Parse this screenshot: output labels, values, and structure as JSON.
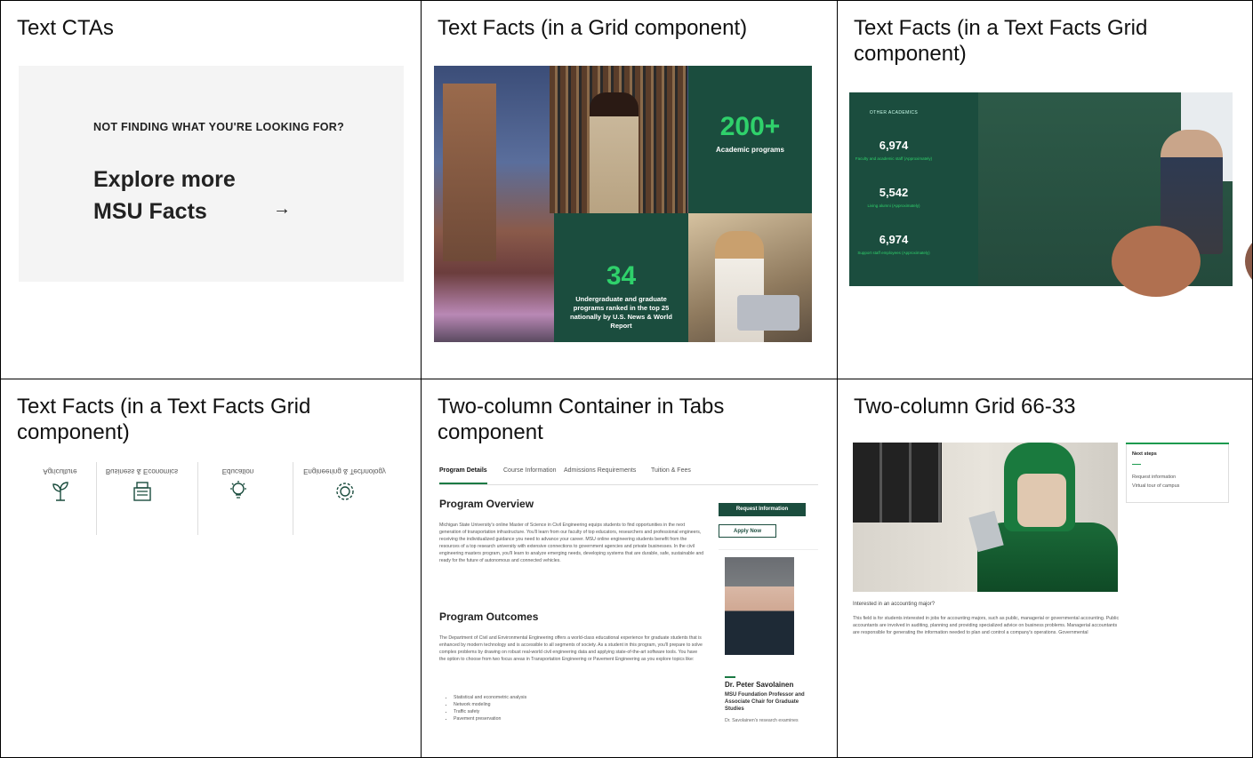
{
  "cells": {
    "c1": {
      "title": "Text CTAs"
    },
    "c2": {
      "title": "Text Facts (in a Grid component)"
    },
    "c3": {
      "title": "Text Facts (in a Text Facts Grid component)"
    },
    "c4": {
      "title": "Text Facts (in a Text Facts Grid component)"
    },
    "c5": {
      "title": "Two-column Container in Tabs component"
    },
    "c6": {
      "title": "Two-column Grid 66-33"
    }
  },
  "cta": {
    "eyebrow": "NOT FINDING WHAT YOU'RE LOOKING FOR?",
    "headline": "Explore more MSU Facts",
    "arrow": "→"
  },
  "grid_facts": {
    "fact1_number": "200+",
    "fact1_label": "Academic programs",
    "fact2_number": "34",
    "fact2_label": "Undergraduate and graduate programs ranked in the top 25 nationally by U.S. News & World Report"
  },
  "text_facts": {
    "eyebrow": "OTHER ACADEMICS",
    "facts": [
      {
        "number": "6,974",
        "label": "Faculty and academic staff (Approximately)"
      },
      {
        "number": "5,542",
        "label": "Living alumni (Approximately)"
      },
      {
        "number": "6,974",
        "label": "Support staff employees (Approximately)"
      }
    ]
  },
  "icon_facts": {
    "items": [
      {
        "label": "Agriculture",
        "icon": "plant-icon"
      },
      {
        "label": "Business & Economics",
        "icon": "register-icon"
      },
      {
        "label": "Education",
        "icon": "lightbulb-icon"
      },
      {
        "label": "Engineering & Technology",
        "icon": "gear-icon"
      }
    ]
  },
  "tabs_page": {
    "tabs": [
      "Program Details",
      "Course Information",
      "Admissions Requirements",
      "Tuition & Fees"
    ],
    "overview_heading": "Program Overview",
    "overview_text": "Michigan State University's online Master of Science in Civil Engineering equips students to find opportunities in the next generation of transportation infrastructure. You'll learn from our faculty of top educators, researchers and professional engineers, receiving the individualized guidance you need to advance your career. MSU online engineering students benefit from the resources of a top research university with extensive connections to government agencies and private businesses. In the civil engineering masters program, you'll learn to analyze emerging needs, developing systems that are durable, safe, sustainable and ready for the future of autonomous and connected vehicles.",
    "outcomes_heading": "Program Outcomes",
    "outcomes_text": "The Department of Civil and Environmental Engineering offers a world-class educational experience for graduate students that is enhanced by modern technology and is accessible to all segments of society. As a student in this program, you'll prepare to solve complex problems by drawing on robust real-world civil engineering data and applying state-of-the-art software tools. You have the option to choose from two focus areas in Transportation Engineering or Pavement Engineering as you explore topics like:",
    "outcomes_list": [
      "Statistical and econometric analysis",
      "Network modeling",
      "Traffic safety",
      "Pavement preservation"
    ],
    "request_button": "Request Information",
    "apply_button": "Apply Now",
    "person_name": "Dr. Peter Savolainen",
    "person_title": "MSU Foundation Professor and Associate Chair for Graduate Studies",
    "person_desc": "Dr. Savolainen's research examines"
  },
  "grid_6633": {
    "next_steps_title": "Next steps",
    "links": [
      "Request information",
      "Virtual tour of campus"
    ],
    "question": "Interested in an accounting major?",
    "body": "This field is for students interested in jobs for accounting majors, such as public, managerial or governmental accounting. Public accountants are involved in auditing, planning and providing specialized advice on business problems. Managerial accountants are responsible for generating the information needed to plan and control a company's operations. Governmental"
  }
}
